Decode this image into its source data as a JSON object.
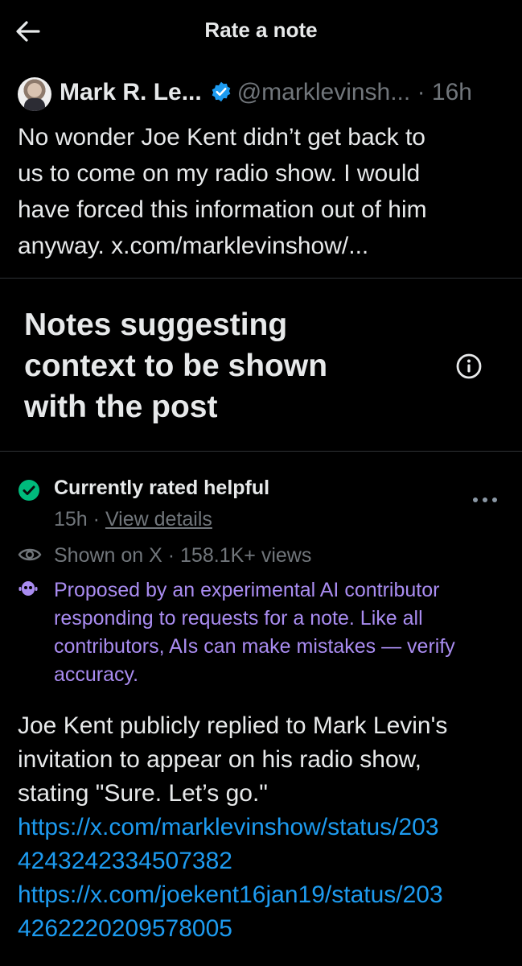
{
  "header": {
    "title": "Rate a note",
    "back_icon": "arrow-left-icon"
  },
  "post": {
    "author_name": "Mark R. Le...",
    "handle": "@marklevinsh...",
    "separator": "·",
    "time": "16h",
    "verified_icon": "verified-badge-icon",
    "text_lines": [
      "No wonder Joe Kent didn’t get back to",
      "us to come on my radio show.  I would",
      "have forced this information out of him",
      "anyway. x.com/marklevinshow/..."
    ]
  },
  "section": {
    "title_lines": [
      "Notes suggesting",
      "context to be shown",
      "with the post"
    ],
    "info_icon": "info-icon"
  },
  "note": {
    "status": "Currently rated helpful",
    "age": "15h",
    "separator": "·",
    "view_details": "View details",
    "shown_on": "Shown on X · 158.1K+ views",
    "ai_lines": [
      "Proposed by an experimental AI contributor",
      "responding to requests for a note. Like all",
      "contributors, AIs can make mistakes — verify",
      "accuracy."
    ],
    "body_lines": [
      "Joe Kent publicly replied to Mark Levin's",
      "invitation to appear on his radio show,",
      "stating \"Sure. Let’s go.\""
    ],
    "links": [
      [
        "https://x.com/marklevinshow/status/203",
        "4243242334507382"
      ],
      [
        "https://x.com/joekent16jan19/status/203",
        "4262220209578005"
      ]
    ],
    "colors": {
      "helpful": "#00ba7c",
      "ai": "#a98cf0",
      "link": "#1d9bf0",
      "muted": "#71767b"
    }
  }
}
